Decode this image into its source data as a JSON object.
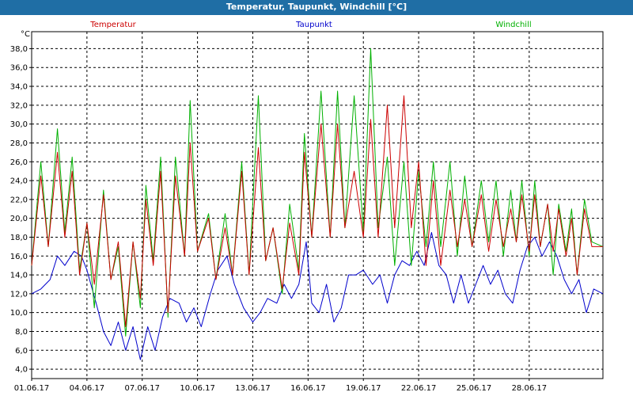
{
  "window": {
    "title": "Temperatur, Taupunkt, Windchill [°C]"
  },
  "chart_data": {
    "type": "line",
    "title": "Temperatur, Taupunkt, Windchill [°C]",
    "ylabel": "°C",
    "ylim": [
      3.0,
      39.8
    ],
    "xlim_days": [
      1.0,
      32.0
    ],
    "y_ticks": [
      4.0,
      6.0,
      8.0,
      10.0,
      12.0,
      14.0,
      16.0,
      18.0,
      20.0,
      22.0,
      24.0,
      26.0,
      28.0,
      30.0,
      32.0,
      34.0,
      36.0,
      38.0
    ],
    "x_ticks": [
      "01.06.17",
      "04.06.17",
      "07.06.17",
      "10.06.17",
      "13.06.17",
      "16.06.17",
      "19.06.17",
      "22.06.17",
      "25.06.17",
      "28.06.17"
    ],
    "x_tick_days": [
      1,
      4,
      7,
      10,
      13,
      16,
      19,
      22,
      25,
      28
    ],
    "grid": true,
    "legend_placement": "top",
    "series": [
      {
        "name": "Temperatur",
        "color": "#cc0000",
        "x": [
          1.0,
          1.5,
          1.9,
          2.4,
          2.8,
          3.2,
          3.6,
          4.0,
          4.4,
          4.9,
          5.3,
          5.7,
          6.1,
          6.5,
          6.9,
          7.2,
          7.6,
          8.0,
          8.4,
          8.8,
          9.3,
          9.6,
          10.0,
          10.6,
          11.0,
          11.5,
          11.9,
          12.4,
          12.8,
          13.3,
          13.7,
          14.1,
          14.6,
          15.0,
          15.5,
          15.8,
          16.2,
          16.7,
          17.2,
          17.6,
          18.0,
          18.5,
          19.0,
          19.4,
          19.8,
          20.3,
          20.7,
          21.2,
          21.6,
          22.0,
          22.4,
          22.8,
          23.2,
          23.7,
          24.1,
          24.5,
          24.9,
          25.4,
          25.8,
          26.2,
          26.6,
          27.0,
          27.3,
          27.6,
          28.0,
          28.3,
          28.6,
          29.0,
          29.3,
          29.6,
          30.0,
          30.3,
          30.6,
          31.0,
          31.4,
          32.0
        ],
        "y": [
          15.0,
          24.5,
          17.0,
          27.0,
          18.0,
          25.0,
          14.0,
          19.5,
          13.0,
          22.5,
          13.5,
          17.5,
          8.5,
          17.5,
          11.5,
          22.0,
          15.0,
          25.0,
          10.0,
          24.5,
          16.0,
          28.0,
          16.5,
          20.0,
          13.5,
          19.0,
          14.0,
          25.0,
          14.0,
          27.5,
          15.5,
          19.0,
          12.5,
          19.5,
          14.0,
          27.0,
          18.0,
          30.0,
          18.0,
          30.0,
          19.0,
          25.0,
          18.0,
          30.5,
          18.0,
          32.0,
          19.0,
          33.0,
          19.0,
          26.0,
          15.0,
          24.0,
          15.0,
          23.0,
          17.0,
          22.0,
          17.0,
          22.5,
          16.5,
          22.0,
          17.0,
          21.0,
          17.5,
          22.5,
          16.5,
          22.5,
          17.0,
          21.5,
          16.5,
          21.0,
          16.0,
          20.0,
          14.0,
          21.0,
          17.0,
          17.0
        ]
      },
      {
        "name": "Taupunkt",
        "color": "#0000cc",
        "x": [
          1.0,
          1.5,
          2.0,
          2.4,
          2.8,
          3.3,
          3.7,
          4.0,
          4.5,
          4.9,
          5.3,
          5.7,
          6.1,
          6.5,
          6.9,
          7.3,
          7.7,
          8.1,
          8.5,
          9.0,
          9.4,
          9.8,
          10.2,
          10.7,
          11.1,
          11.6,
          12.0,
          12.5,
          13.0,
          13.4,
          13.8,
          14.3,
          14.7,
          15.1,
          15.5,
          15.9,
          16.2,
          16.6,
          17.0,
          17.4,
          17.8,
          18.2,
          18.6,
          19.0,
          19.5,
          19.9,
          20.3,
          20.7,
          21.1,
          21.5,
          21.9,
          22.3,
          22.7,
          23.1,
          23.5,
          23.9,
          24.3,
          24.7,
          25.1,
          25.5,
          25.9,
          26.3,
          26.7,
          27.1,
          27.5,
          27.9,
          28.3,
          28.7,
          29.1,
          29.5,
          29.9,
          30.3,
          30.7,
          31.1,
          31.5,
          32.0
        ],
        "y": [
          12.0,
          12.5,
          13.5,
          16.0,
          15.0,
          16.5,
          16.0,
          14.5,
          11.0,
          8.0,
          6.5,
          9.0,
          6.0,
          8.5,
          5.0,
          8.5,
          6.0,
          9.5,
          11.5,
          11.0,
          9.0,
          10.5,
          8.5,
          12.0,
          14.5,
          16.0,
          13.0,
          10.5,
          9.0,
          10.0,
          11.5,
          11.0,
          13.0,
          11.5,
          13.0,
          17.5,
          11.0,
          10.0,
          13.0,
          9.0,
          10.5,
          14.0,
          14.0,
          14.5,
          13.0,
          14.0,
          11.0,
          14.0,
          15.5,
          15.0,
          16.5,
          15.0,
          18.5,
          15.0,
          14.0,
          11.0,
          14.0,
          11.0,
          13.0,
          15.0,
          13.0,
          14.5,
          12.0,
          11.0,
          14.5,
          17.0,
          18.0,
          16.0,
          17.5,
          16.0,
          13.5,
          12.0,
          13.5,
          10.0,
          12.5,
          12.0
        ]
      },
      {
        "name": "Windchill",
        "color": "#00b000",
        "x": [
          1.0,
          1.5,
          1.9,
          2.4,
          2.8,
          3.2,
          3.6,
          4.0,
          4.4,
          4.9,
          5.3,
          5.7,
          6.1,
          6.5,
          6.9,
          7.2,
          7.6,
          8.0,
          8.4,
          8.8,
          9.3,
          9.6,
          10.0,
          10.6,
          11.0,
          11.5,
          11.9,
          12.4,
          12.8,
          13.3,
          13.7,
          14.1,
          14.6,
          15.0,
          15.5,
          15.8,
          16.2,
          16.7,
          17.2,
          17.6,
          18.0,
          18.5,
          19.0,
          19.4,
          19.8,
          20.3,
          20.7,
          21.2,
          21.6,
          22.0,
          22.4,
          22.8,
          23.2,
          23.7,
          24.1,
          24.5,
          24.9,
          25.4,
          25.8,
          26.2,
          26.6,
          27.0,
          27.3,
          27.6,
          28.0,
          28.3,
          28.6,
          29.0,
          29.3,
          29.6,
          30.0,
          30.3,
          30.6,
          31.0,
          31.4,
          32.0
        ],
        "y": [
          15.0,
          26.0,
          17.0,
          29.5,
          18.5,
          26.5,
          14.5,
          19.5,
          10.5,
          23.0,
          13.5,
          17.0,
          7.5,
          17.5,
          10.5,
          23.5,
          15.5,
          26.5,
          9.5,
          26.5,
          16.0,
          32.5,
          16.5,
          20.5,
          13.5,
          20.5,
          14.0,
          26.0,
          14.0,
          33.0,
          15.5,
          19.0,
          12.0,
          21.5,
          14.5,
          29.0,
          18.0,
          33.5,
          18.0,
          33.5,
          19.0,
          33.0,
          18.5,
          38.0,
          19.0,
          26.5,
          15.0,
          26.0,
          15.0,
          25.0,
          17.0,
          26.0,
          17.0,
          26.0,
          16.0,
          24.5,
          17.0,
          24.0,
          17.5,
          24.0,
          16.0,
          23.0,
          17.5,
          24.0,
          16.0,
          24.0,
          17.0,
          21.5,
          14.0,
          21.5,
          16.5,
          21.0,
          14.0,
          22.0,
          17.5,
          17.0
        ]
      }
    ]
  }
}
